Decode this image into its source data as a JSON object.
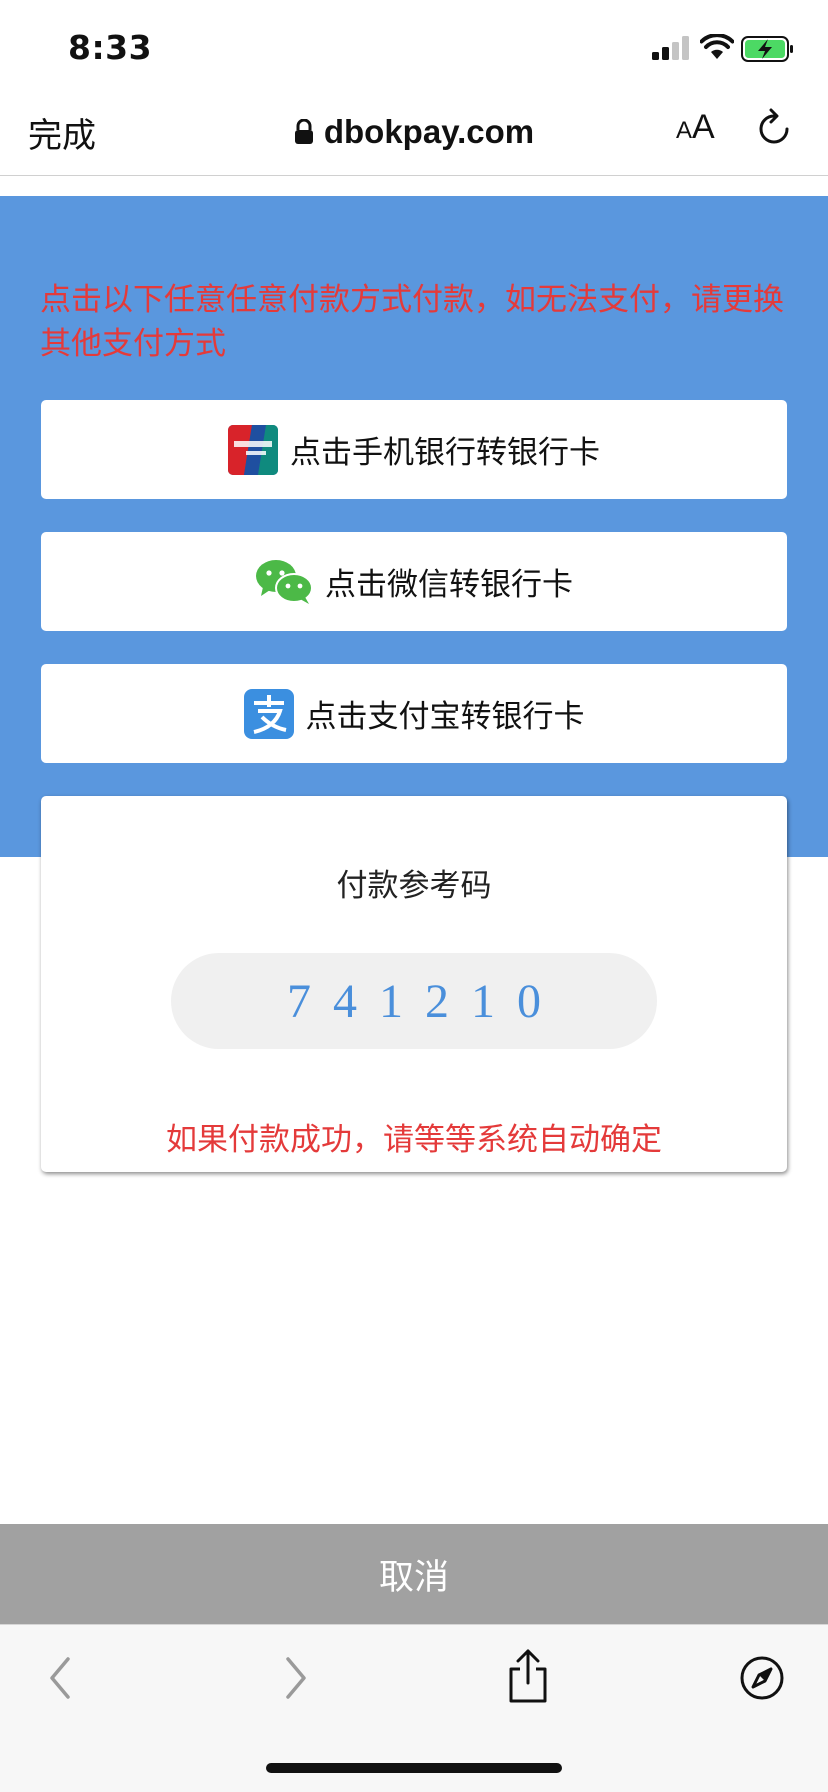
{
  "status_bar": {
    "time": "8:33",
    "icons": [
      "signal-icon",
      "wifi-icon",
      "battery-charging-icon"
    ],
    "battery_color": "#4cd964"
  },
  "browser": {
    "done_label": "完成",
    "url": "dbokpay.com",
    "text_size_small": "A",
    "text_size_big": "A",
    "icons": [
      "lock-icon",
      "reload-icon"
    ]
  },
  "page": {
    "notice": "点击以下任意任意付款方式付款，如无法支付，请更换其他支付方式",
    "payment_methods": [
      {
        "label": "点击手机银行转银行卡",
        "icon": "unionpay-icon"
      },
      {
        "label": "点击微信转银行卡",
        "icon": "wechat-icon"
      },
      {
        "label": "点击支付宝转银行卡",
        "icon": "alipay-icon"
      }
    ],
    "reference": {
      "title": "付款参考码",
      "code": "741210",
      "note": "如果付款成功，请等等系统自动确定"
    },
    "cancel_label": "取消"
  },
  "colors": {
    "header_blue": "#5a97de",
    "alert_red": "#e43a3a",
    "code_blue": "#4a8fdb",
    "cancel_gray": "#a1a1a1",
    "wechat_green": "#4cb947",
    "alipay_blue": "#3b8fe0"
  },
  "toolbar": {
    "icons": [
      "back-icon",
      "forward-icon",
      "share-icon",
      "compass-icon"
    ]
  }
}
